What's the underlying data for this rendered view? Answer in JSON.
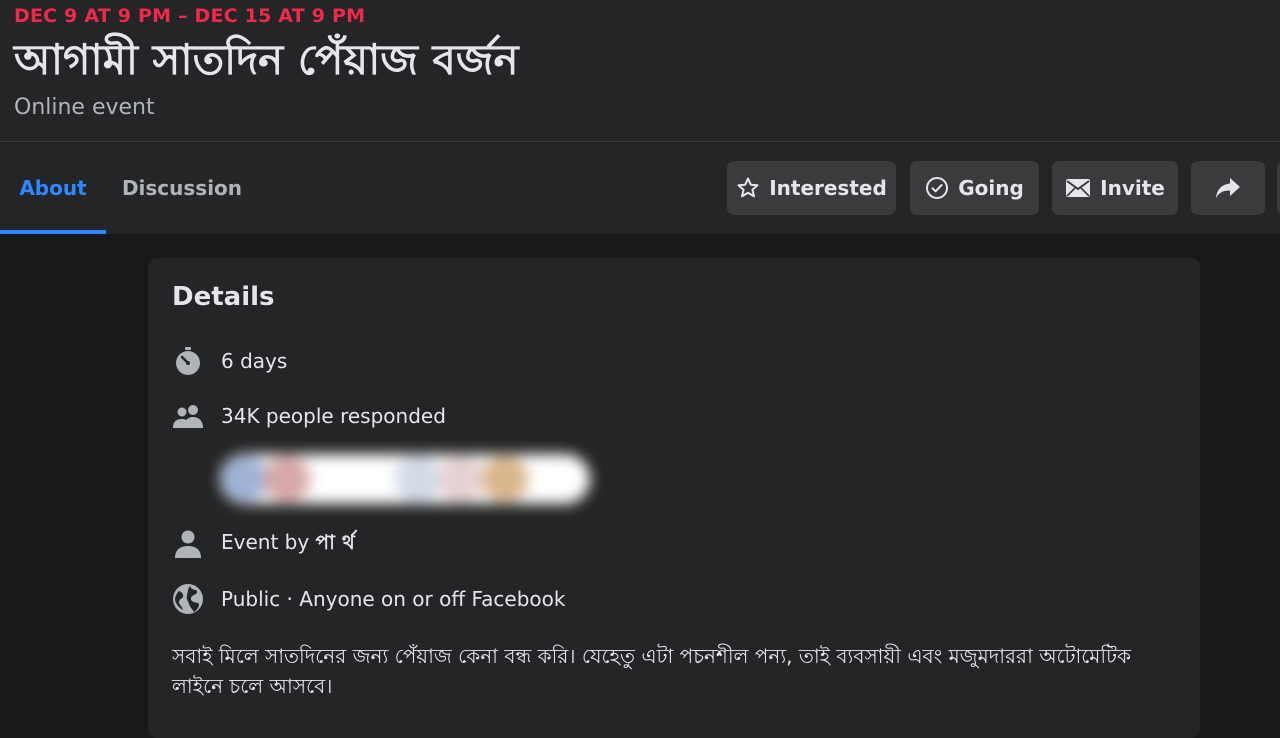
{
  "event": {
    "date": "DEC 9 AT 9 PM – DEC 15 AT 9 PM",
    "title": "আগামী সাতদিন পেঁয়াজ বর্জন",
    "subtitle": "Online event"
  },
  "tabs": [
    {
      "label": "About",
      "active": true
    },
    {
      "label": "Discussion",
      "active": false
    }
  ],
  "actions": {
    "interested_label": "Interested",
    "going_label": "Going",
    "invite_label": "Invite"
  },
  "details": {
    "title": "Details",
    "duration": "6 days",
    "responded": "34K people responded",
    "event_by_prefix": "Event by",
    "host": "পা র্থ",
    "privacy": "Public · Anyone on or off Facebook",
    "description": "সবাই মিলে সাতদিনের জন্য পেঁয়াজ কেনা বন্ধ করি। যেহেতু এটা পচনশীল পন্য, তাই ব্যবসায়ী এবং মজুমদাররা অটোমেটিক লাইনে চলে আসবে।"
  },
  "colors": {
    "accent": "#2d88ff",
    "date": "#f02849",
    "background": "#18191a",
    "surface": "#242526",
    "button": "#3a3b3c"
  },
  "icons": [
    "star-icon",
    "check-circle-icon",
    "envelope-icon",
    "share-arrow-icon",
    "stopwatch-icon",
    "people-icon",
    "person-icon",
    "globe-icon"
  ]
}
